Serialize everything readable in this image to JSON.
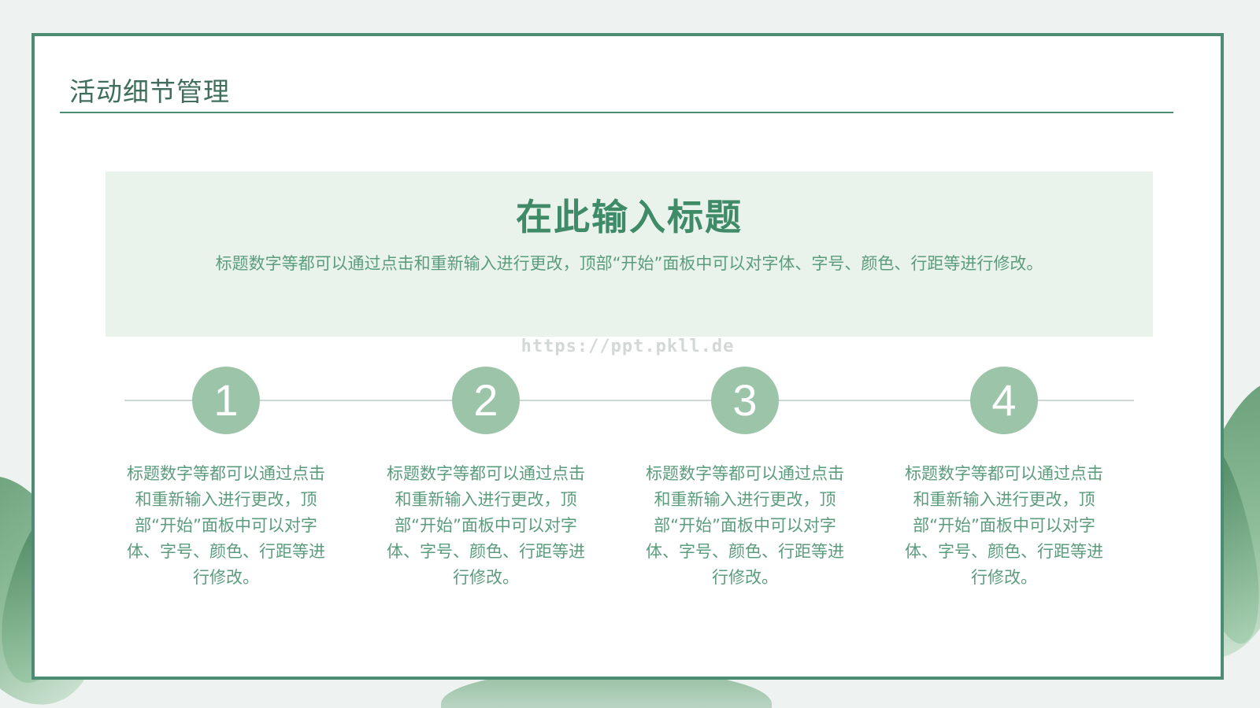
{
  "slide": {
    "title": "活动细节管理"
  },
  "panel": {
    "heading": "在此输入标题",
    "description": "标题数字等都可以通过点击和重新输入进行更改，顶部“开始”面板中可以对字体、字号、颜色、行距等进行修改。"
  },
  "watermark": "https://ppt.pkll.de",
  "steps": [
    {
      "number": "1",
      "text": "标题数字等都可以通过点击和重新输入进行更改，顶部“开始”面板中可以对字体、字号、颜色、行距等进行修改。"
    },
    {
      "number": "2",
      "text": "标题数字等都可以通过点击和重新输入进行更改，顶部“开始”面板中可以对字体、字号、颜色、行距等进行修改。"
    },
    {
      "number": "3",
      "text": "标题数字等都可以通过点击和重新输入进行更改，顶部“开始”面板中可以对字体、字号、颜色、行距等进行修改。"
    },
    {
      "number": "4",
      "text": "标题数字等都可以通过点击和重新输入进行更改，顶部“开始”面板中可以对字体、字号、颜色、行距等进行修改。"
    }
  ],
  "colors": {
    "accent": "#4b8c72",
    "heading": "#3f8a67",
    "circle": "#9cc4a9",
    "panel_bg": "#e9f3ec"
  }
}
